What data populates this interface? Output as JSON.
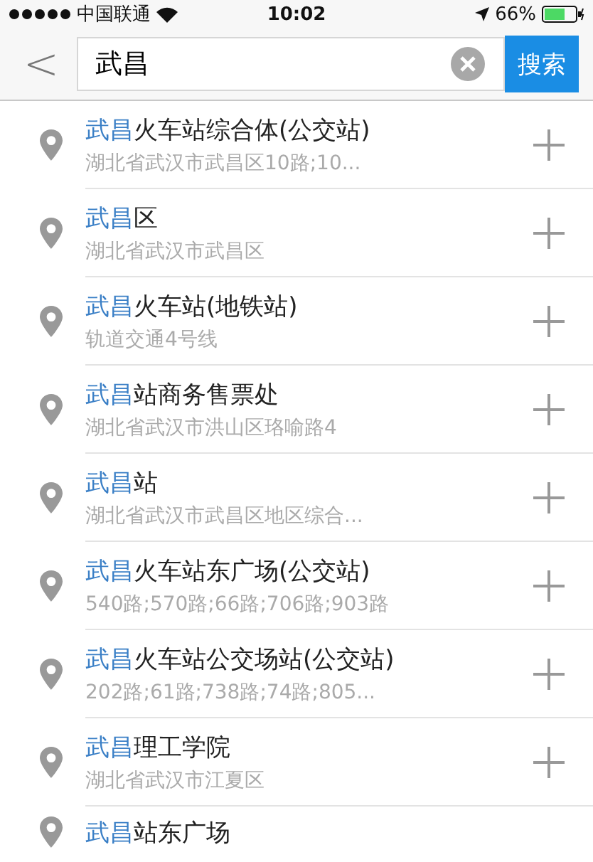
{
  "status_bar": {
    "carrier": "中国联通",
    "time": "10:02",
    "battery_percent": "66%"
  },
  "nav": {
    "back": "<",
    "search_value": "武昌",
    "search_button": "搜索"
  },
  "results": [
    {
      "match": "武昌",
      "rest": "火车站综合体(公交站)",
      "subtitle": "湖北省武汉市武昌区10路;10..."
    },
    {
      "match": "武昌",
      "rest": "区",
      "subtitle": "湖北省武汉市武昌区"
    },
    {
      "match": "武昌",
      "rest": "火车站(地铁站)",
      "subtitle": "轨道交通4号线"
    },
    {
      "match": "武昌",
      "rest": "站商务售票处",
      "subtitle": "湖北省武汉市洪山区珞喻路4"
    },
    {
      "match": "武昌",
      "rest": "站",
      "subtitle": "湖北省武汉市武昌区地区综合..."
    },
    {
      "match": "武昌",
      "rest": "火车站东广场(公交站)",
      "subtitle": "540路;570路;66路;706路;903路"
    },
    {
      "match": "武昌",
      "rest": "火车站公交场站(公交站)",
      "subtitle": "202路;61路;738路;74路;805..."
    },
    {
      "match": "武昌",
      "rest": "理工学院",
      "subtitle": "湖北省武汉市江夏区"
    },
    {
      "match": "武昌",
      "rest": "站东广场"
    }
  ]
}
